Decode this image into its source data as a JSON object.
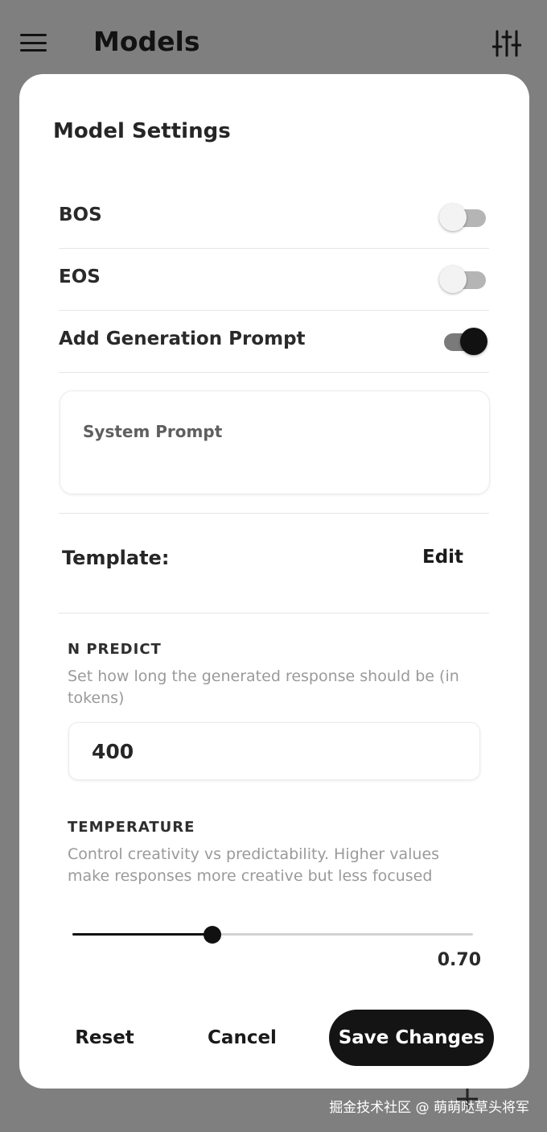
{
  "header": {
    "title": "Models",
    "menu_icon": "hamburger-menu-icon",
    "settings_icon": "tune-sliders-icon"
  },
  "modal": {
    "title": "Model Settings",
    "toggles": [
      {
        "label": "BOS",
        "on": false
      },
      {
        "label": "EOS",
        "on": false
      },
      {
        "label": "Add Generation Prompt",
        "on": true
      }
    ],
    "system_prompt": {
      "placeholder": "System Prompt",
      "value": ""
    },
    "template": {
      "label": "Template:",
      "edit_label": "Edit"
    },
    "n_predict": {
      "title": "N PREDICT",
      "description": "Set how long the generated response should be (in tokens)",
      "value": "400"
    },
    "temperature": {
      "title": "TEMPERATURE",
      "description": "Control creativity vs predictability. Higher values make responses more creative but less focused",
      "value_text": "0.70",
      "value": 0.7,
      "min": 0,
      "max": 2
    },
    "footer": {
      "reset_label": "Reset",
      "cancel_label": "Cancel",
      "save_label": "Save Changes"
    }
  },
  "watermark": "掘金技术社区 @ 萌萌哒草头将军",
  "colors": {
    "accent": "#141414",
    "overlay": "#7f7f7f",
    "muted_text": "#9a9a9a"
  }
}
